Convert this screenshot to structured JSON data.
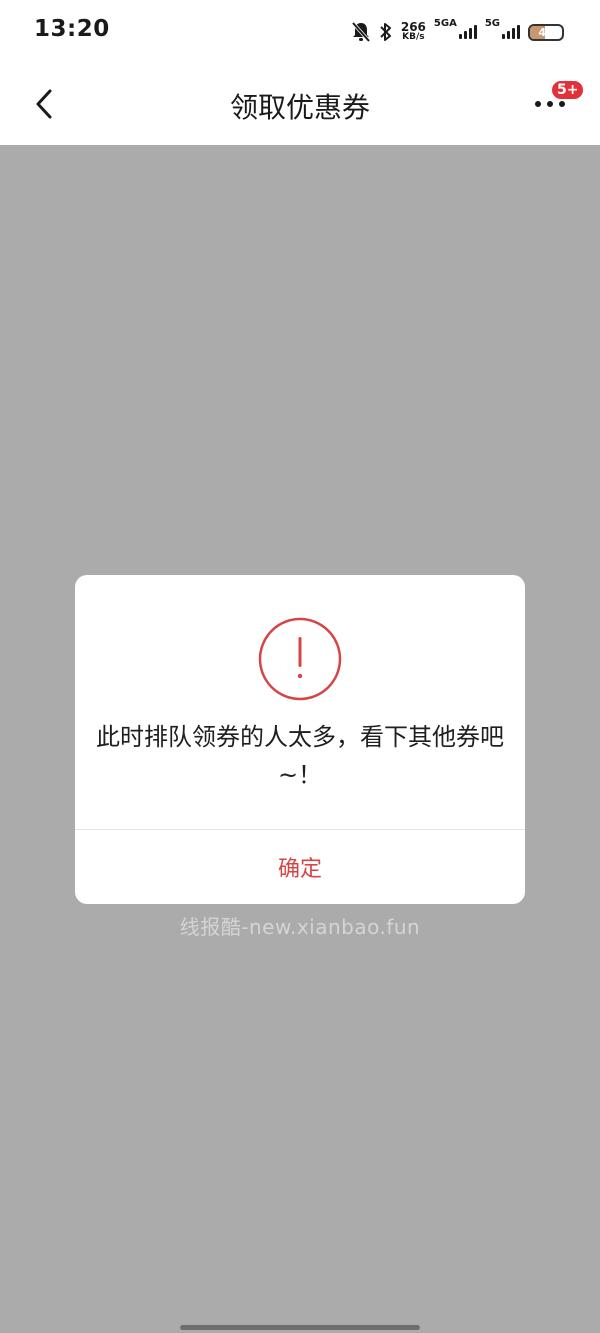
{
  "status_bar": {
    "time": "13:20",
    "speed_value": "266",
    "speed_unit": "KB/s",
    "net1_label": "5GA",
    "net2_label": "5G",
    "battery_level": "46",
    "icons": [
      "mute-bell-icon",
      "bluetooth-icon",
      "signal-bars-icon",
      "battery-icon"
    ]
  },
  "navbar": {
    "title": "领取优惠券",
    "back_icon": "chevron-left-icon",
    "more_icon": "ellipsis-icon",
    "badge": "5+"
  },
  "dialog": {
    "icon": "exclamation-circle-icon",
    "message": "此时排队领券的人太多，看下其他券吧~！",
    "confirm_label": "确定"
  },
  "watermark": "线报酷-new.xianbao.fun",
  "colors": {
    "overlay": "#ababab",
    "accent_red": "#d64545",
    "badge_red": "#e3313a",
    "battery_fill": "#c89670"
  }
}
